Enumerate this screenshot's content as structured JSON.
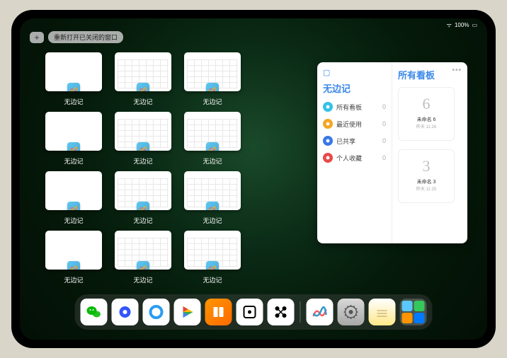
{
  "statusbar": {
    "signal": "ᯤ",
    "battery": "100%"
  },
  "topbar": {
    "plus": "+",
    "reopen_label": "重新打开已关闭的窗口"
  },
  "app_name": "无边记",
  "windows": [
    {
      "label": "无边记",
      "variant": "blank"
    },
    {
      "label": "无边记",
      "variant": "cal"
    },
    {
      "label": "无边记",
      "variant": "cal"
    },
    {
      "label": "无边记",
      "variant": "blank"
    },
    {
      "label": "无边记",
      "variant": "cal"
    },
    {
      "label": "无边记",
      "variant": "cal"
    },
    {
      "label": "无边记",
      "variant": "blank"
    },
    {
      "label": "无边记",
      "variant": "cal"
    },
    {
      "label": "无边记",
      "variant": "cal"
    },
    {
      "label": "无边记",
      "variant": "blank"
    },
    {
      "label": "无边记",
      "variant": "cal"
    },
    {
      "label": "无边记",
      "variant": "cal"
    }
  ],
  "panel": {
    "left_title": "无边记",
    "right_title": "所有看板",
    "sidebar": [
      {
        "icon_color": "#34c1e8",
        "label": "所有看板",
        "count": "0"
      },
      {
        "icon_color": "#f5a623",
        "label": "最近使用",
        "count": "0"
      },
      {
        "icon_color": "#3a77e8",
        "label": "已共享",
        "count": "0"
      },
      {
        "icon_color": "#e84a4a",
        "label": "个人收藏",
        "count": "0"
      }
    ],
    "boards": [
      {
        "drawing": "6",
        "title": "未命名 6",
        "sub": "昨天 11:26"
      },
      {
        "drawing": "3",
        "title": "未命名 3",
        "sub": "昨天 11:25"
      }
    ]
  },
  "dock": [
    {
      "name": "wechat",
      "bg": "#ffffff",
      "glyph_color": "#09bb07"
    },
    {
      "name": "quark",
      "bg": "#ffffff",
      "glyph_color": "#3355ff"
    },
    {
      "name": "qqbrowser",
      "bg": "#ffffff",
      "glyph_color": "#2a9df4"
    },
    {
      "name": "play",
      "bg": "#ffffff",
      "glyph_color": "#34a853"
    },
    {
      "name": "books",
      "bg": "linear-gradient(135deg,#ff9500,#ff6a00)",
      "glyph_color": "#fff"
    },
    {
      "name": "dice",
      "bg": "#ffffff",
      "glyph_color": "#000"
    },
    {
      "name": "connect",
      "bg": "#ffffff",
      "glyph_color": "#000"
    }
  ],
  "dock_recent": [
    {
      "name": "freeform",
      "bg": "#ffffff"
    },
    {
      "name": "settings",
      "bg": "linear-gradient(#d8d8d8,#a8a8a8)"
    },
    {
      "name": "notes",
      "bg": "linear-gradient(#fff,#ffe88a)"
    }
  ]
}
